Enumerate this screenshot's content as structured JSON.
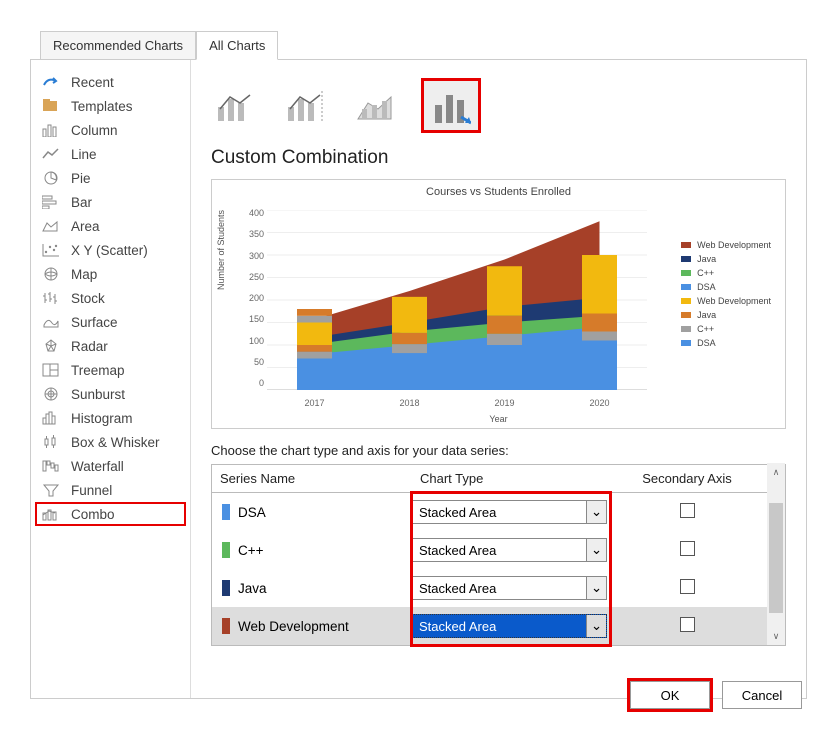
{
  "tabs": {
    "recommended": "Recommended Charts",
    "all": "All Charts"
  },
  "sidebar": {
    "items": [
      {
        "label": "Recent"
      },
      {
        "label": "Templates"
      },
      {
        "label": "Column"
      },
      {
        "label": "Line"
      },
      {
        "label": "Pie"
      },
      {
        "label": "Bar"
      },
      {
        "label": "Area"
      },
      {
        "label": "X Y (Scatter)"
      },
      {
        "label": "Map"
      },
      {
        "label": "Stock"
      },
      {
        "label": "Surface"
      },
      {
        "label": "Radar"
      },
      {
        "label": "Treemap"
      },
      {
        "label": "Sunburst"
      },
      {
        "label": "Histogram"
      },
      {
        "label": "Box & Whisker"
      },
      {
        "label": "Waterfall"
      },
      {
        "label": "Funnel"
      },
      {
        "label": "Combo"
      }
    ]
  },
  "main": {
    "title": "Custom Combination",
    "instruction": "Choose the chart type and axis for your data series:",
    "headers": {
      "name": "Series Name",
      "type": "Chart Type",
      "axis": "Secondary Axis"
    },
    "series": [
      {
        "name": "DSA",
        "chart_type": "Stacked Area",
        "color": "#4A90E2"
      },
      {
        "name": "C++",
        "chart_type": "Stacked Area",
        "color": "#5CB85C"
      },
      {
        "name": "Java",
        "chart_type": "Stacked Area",
        "color": "#1E3A72"
      },
      {
        "name": "Web Development",
        "chart_type": "Stacked Area",
        "color": "#A64028"
      }
    ]
  },
  "buttons": {
    "ok": "OK",
    "cancel": "Cancel"
  },
  "chart_data": {
    "type": "combo-stacked-area-with-bars",
    "title": "Courses vs Students Enrolled",
    "xlabel": "Year",
    "ylabel": "Number of Students",
    "ylim": [
      0,
      400
    ],
    "yticks": [
      0,
      50,
      100,
      150,
      200,
      250,
      300,
      350,
      400
    ],
    "categories": [
      "2017",
      "2018",
      "2019",
      "2020"
    ],
    "area_series": [
      {
        "name": "DSA",
        "color": "#4A90E2",
        "values": [
          80,
          100,
          120,
          140
        ]
      },
      {
        "name": "C++",
        "color": "#5CB85C",
        "values": [
          22,
          30,
          30,
          25
        ]
      },
      {
        "name": "Java",
        "color": "#1E3A72",
        "values": [
          15,
          20,
          35,
          40
        ]
      },
      {
        "name": "Web Development",
        "color": "#A64028",
        "values": [
          40,
          70,
          105,
          170
        ]
      }
    ],
    "bar_series": [
      {
        "name": "DSA",
        "color": "#4A90E2",
        "values": [
          70,
          82,
          100,
          110
        ]
      },
      {
        "name": "C++",
        "color": "#A0A0A0",
        "values": [
          15,
          20,
          25,
          20
        ]
      },
      {
        "name": "Java",
        "color": "#D67B2A",
        "values": [
          15,
          25,
          40,
          40
        ]
      },
      {
        "name": "Web Development",
        "color": "#F2B90F",
        "values": [
          50,
          80,
          110,
          130
        ]
      }
    ],
    "legend": [
      {
        "name": "Web Development",
        "color": "#A64028"
      },
      {
        "name": "Java",
        "color": "#1E3A72"
      },
      {
        "name": "C++",
        "color": "#5CB85C"
      },
      {
        "name": "DSA",
        "color": "#4A90E2"
      },
      {
        "name": "Web Development",
        "color": "#F2B90F"
      },
      {
        "name": "Java",
        "color": "#D67B2A"
      },
      {
        "name": "C++",
        "color": "#A0A0A0"
      },
      {
        "name": "DSA",
        "color": "#4A90E2"
      }
    ]
  }
}
